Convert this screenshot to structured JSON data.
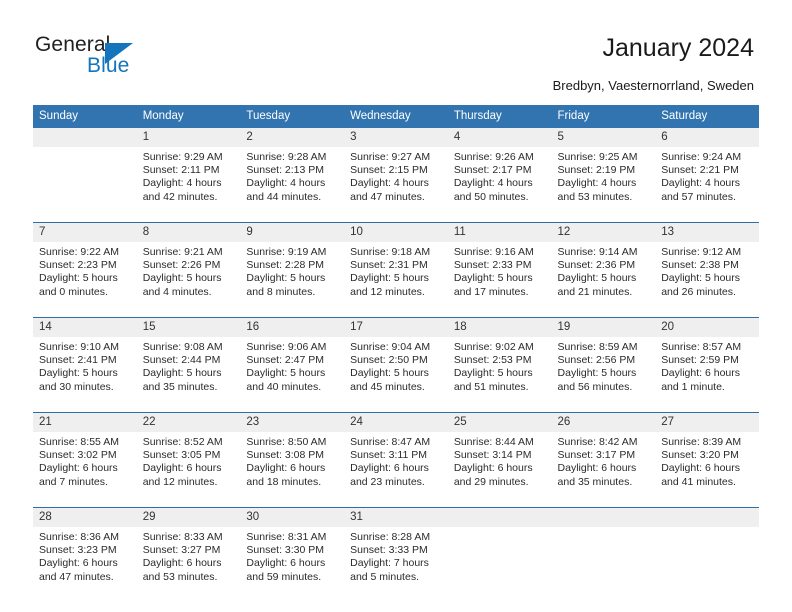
{
  "brand": {
    "name_part1": "General",
    "name_part2": "Blue"
  },
  "header": {
    "title": "January 2024",
    "location": "Bredbyn, Vaesternorrland, Sweden"
  },
  "colors": {
    "header_blue": "#3174b0",
    "separator_blue": "#2f6fa8",
    "daynum_band": "#efefef",
    "logo_blue": "#1474bc"
  },
  "weekday_headers": [
    "Sunday",
    "Monday",
    "Tuesday",
    "Wednesday",
    "Thursday",
    "Friday",
    "Saturday"
  ],
  "weeks": [
    {
      "numbers": [
        "",
        "1",
        "2",
        "3",
        "4",
        "5",
        "6"
      ],
      "cells": [
        {
          "sunrise": "",
          "sunset": "",
          "daylight1": "",
          "daylight2": ""
        },
        {
          "sunrise": "Sunrise: 9:29 AM",
          "sunset": "Sunset: 2:11 PM",
          "daylight1": "Daylight: 4 hours",
          "daylight2": "and 42 minutes."
        },
        {
          "sunrise": "Sunrise: 9:28 AM",
          "sunset": "Sunset: 2:13 PM",
          "daylight1": "Daylight: 4 hours",
          "daylight2": "and 44 minutes."
        },
        {
          "sunrise": "Sunrise: 9:27 AM",
          "sunset": "Sunset: 2:15 PM",
          "daylight1": "Daylight: 4 hours",
          "daylight2": "and 47 minutes."
        },
        {
          "sunrise": "Sunrise: 9:26 AM",
          "sunset": "Sunset: 2:17 PM",
          "daylight1": "Daylight: 4 hours",
          "daylight2": "and 50 minutes."
        },
        {
          "sunrise": "Sunrise: 9:25 AM",
          "sunset": "Sunset: 2:19 PM",
          "daylight1": "Daylight: 4 hours",
          "daylight2": "and 53 minutes."
        },
        {
          "sunrise": "Sunrise: 9:24 AM",
          "sunset": "Sunset: 2:21 PM",
          "daylight1": "Daylight: 4 hours",
          "daylight2": "and 57 minutes."
        }
      ]
    },
    {
      "numbers": [
        "7",
        "8",
        "9",
        "10",
        "11",
        "12",
        "13"
      ],
      "cells": [
        {
          "sunrise": "Sunrise: 9:22 AM",
          "sunset": "Sunset: 2:23 PM",
          "daylight1": "Daylight: 5 hours",
          "daylight2": "and 0 minutes."
        },
        {
          "sunrise": "Sunrise: 9:21 AM",
          "sunset": "Sunset: 2:26 PM",
          "daylight1": "Daylight: 5 hours",
          "daylight2": "and 4 minutes."
        },
        {
          "sunrise": "Sunrise: 9:19 AM",
          "sunset": "Sunset: 2:28 PM",
          "daylight1": "Daylight: 5 hours",
          "daylight2": "and 8 minutes."
        },
        {
          "sunrise": "Sunrise: 9:18 AM",
          "sunset": "Sunset: 2:31 PM",
          "daylight1": "Daylight: 5 hours",
          "daylight2": "and 12 minutes."
        },
        {
          "sunrise": "Sunrise: 9:16 AM",
          "sunset": "Sunset: 2:33 PM",
          "daylight1": "Daylight: 5 hours",
          "daylight2": "and 17 minutes."
        },
        {
          "sunrise": "Sunrise: 9:14 AM",
          "sunset": "Sunset: 2:36 PM",
          "daylight1": "Daylight: 5 hours",
          "daylight2": "and 21 minutes."
        },
        {
          "sunrise": "Sunrise: 9:12 AM",
          "sunset": "Sunset: 2:38 PM",
          "daylight1": "Daylight: 5 hours",
          "daylight2": "and 26 minutes."
        }
      ]
    },
    {
      "numbers": [
        "14",
        "15",
        "16",
        "17",
        "18",
        "19",
        "20"
      ],
      "cells": [
        {
          "sunrise": "Sunrise: 9:10 AM",
          "sunset": "Sunset: 2:41 PM",
          "daylight1": "Daylight: 5 hours",
          "daylight2": "and 30 minutes."
        },
        {
          "sunrise": "Sunrise: 9:08 AM",
          "sunset": "Sunset: 2:44 PM",
          "daylight1": "Daylight: 5 hours",
          "daylight2": "and 35 minutes."
        },
        {
          "sunrise": "Sunrise: 9:06 AM",
          "sunset": "Sunset: 2:47 PM",
          "daylight1": "Daylight: 5 hours",
          "daylight2": "and 40 minutes."
        },
        {
          "sunrise": "Sunrise: 9:04 AM",
          "sunset": "Sunset: 2:50 PM",
          "daylight1": "Daylight: 5 hours",
          "daylight2": "and 45 minutes."
        },
        {
          "sunrise": "Sunrise: 9:02 AM",
          "sunset": "Sunset: 2:53 PM",
          "daylight1": "Daylight: 5 hours",
          "daylight2": "and 51 minutes."
        },
        {
          "sunrise": "Sunrise: 8:59 AM",
          "sunset": "Sunset: 2:56 PM",
          "daylight1": "Daylight: 5 hours",
          "daylight2": "and 56 minutes."
        },
        {
          "sunrise": "Sunrise: 8:57 AM",
          "sunset": "Sunset: 2:59 PM",
          "daylight1": "Daylight: 6 hours",
          "daylight2": "and 1 minute."
        }
      ]
    },
    {
      "numbers": [
        "21",
        "22",
        "23",
        "24",
        "25",
        "26",
        "27"
      ],
      "cells": [
        {
          "sunrise": "Sunrise: 8:55 AM",
          "sunset": "Sunset: 3:02 PM",
          "daylight1": "Daylight: 6 hours",
          "daylight2": "and 7 minutes."
        },
        {
          "sunrise": "Sunrise: 8:52 AM",
          "sunset": "Sunset: 3:05 PM",
          "daylight1": "Daylight: 6 hours",
          "daylight2": "and 12 minutes."
        },
        {
          "sunrise": "Sunrise: 8:50 AM",
          "sunset": "Sunset: 3:08 PM",
          "daylight1": "Daylight: 6 hours",
          "daylight2": "and 18 minutes."
        },
        {
          "sunrise": "Sunrise: 8:47 AM",
          "sunset": "Sunset: 3:11 PM",
          "daylight1": "Daylight: 6 hours",
          "daylight2": "and 23 minutes."
        },
        {
          "sunrise": "Sunrise: 8:44 AM",
          "sunset": "Sunset: 3:14 PM",
          "daylight1": "Daylight: 6 hours",
          "daylight2": "and 29 minutes."
        },
        {
          "sunrise": "Sunrise: 8:42 AM",
          "sunset": "Sunset: 3:17 PM",
          "daylight1": "Daylight: 6 hours",
          "daylight2": "and 35 minutes."
        },
        {
          "sunrise": "Sunrise: 8:39 AM",
          "sunset": "Sunset: 3:20 PM",
          "daylight1": "Daylight: 6 hours",
          "daylight2": "and 41 minutes."
        }
      ]
    },
    {
      "numbers": [
        "28",
        "29",
        "30",
        "31",
        "",
        "",
        ""
      ],
      "cells": [
        {
          "sunrise": "Sunrise: 8:36 AM",
          "sunset": "Sunset: 3:23 PM",
          "daylight1": "Daylight: 6 hours",
          "daylight2": "and 47 minutes."
        },
        {
          "sunrise": "Sunrise: 8:33 AM",
          "sunset": "Sunset: 3:27 PM",
          "daylight1": "Daylight: 6 hours",
          "daylight2": "and 53 minutes."
        },
        {
          "sunrise": "Sunrise: 8:31 AM",
          "sunset": "Sunset: 3:30 PM",
          "daylight1": "Daylight: 6 hours",
          "daylight2": "and 59 minutes."
        },
        {
          "sunrise": "Sunrise: 8:28 AM",
          "sunset": "Sunset: 3:33 PM",
          "daylight1": "Daylight: 7 hours",
          "daylight2": "and 5 minutes."
        },
        {
          "sunrise": "",
          "sunset": "",
          "daylight1": "",
          "daylight2": ""
        },
        {
          "sunrise": "",
          "sunset": "",
          "daylight1": "",
          "daylight2": ""
        },
        {
          "sunrise": "",
          "sunset": "",
          "daylight1": "",
          "daylight2": ""
        }
      ]
    }
  ]
}
